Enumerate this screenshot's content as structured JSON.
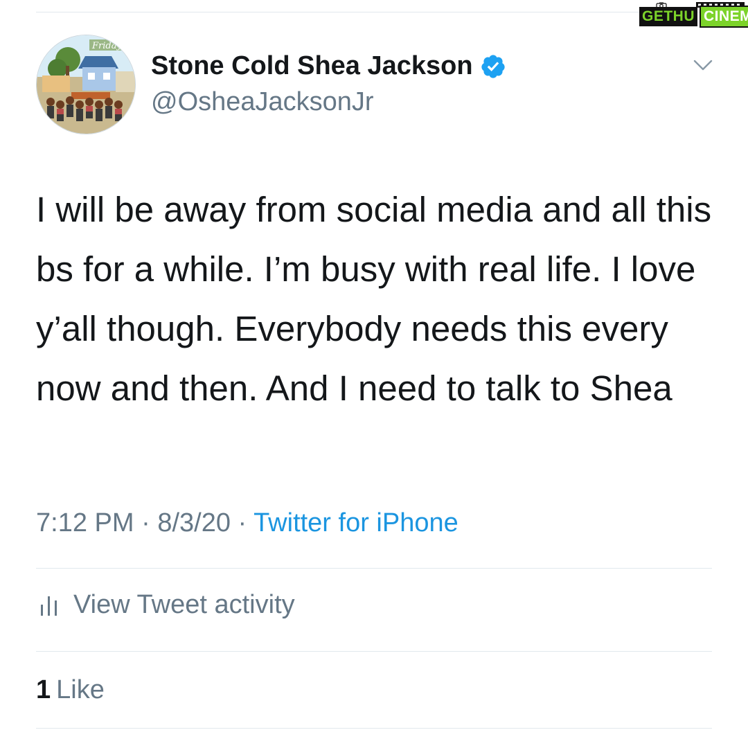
{
  "watermark": {
    "part1": "GETHU",
    "part2": "CINEMA",
    "camera_icon": "camera-icon",
    "film_icon": "film-strip-icon",
    "colors": {
      "green": "#7cd32a",
      "dark": "#111111"
    }
  },
  "tweet": {
    "avatar_icon": "profile-avatar",
    "avatar_sign_text": "Friday",
    "display_name": "Stone Cold Shea Jackson",
    "verified_icon": "verified-badge-icon",
    "handle": "@OsheaJacksonJr",
    "menu_icon": "chevron-down-icon",
    "text": "I will be away from social media and all this bs for a while. I’m busy with real life. I love y’all though. Everybody needs this every now and then. And I need to talk to Shea",
    "time": "7:12 PM",
    "separator": " · ",
    "date": "8/3/20",
    "source": "Twitter for iPhone"
  },
  "activity": {
    "icon": "bar-chart-icon",
    "label": "View Tweet activity"
  },
  "likes": {
    "count": "1",
    "label": "Like"
  },
  "colors": {
    "text": "#14171a",
    "secondary": "#657786",
    "link": "#1b95e0",
    "divider": "#e1e8ed"
  }
}
